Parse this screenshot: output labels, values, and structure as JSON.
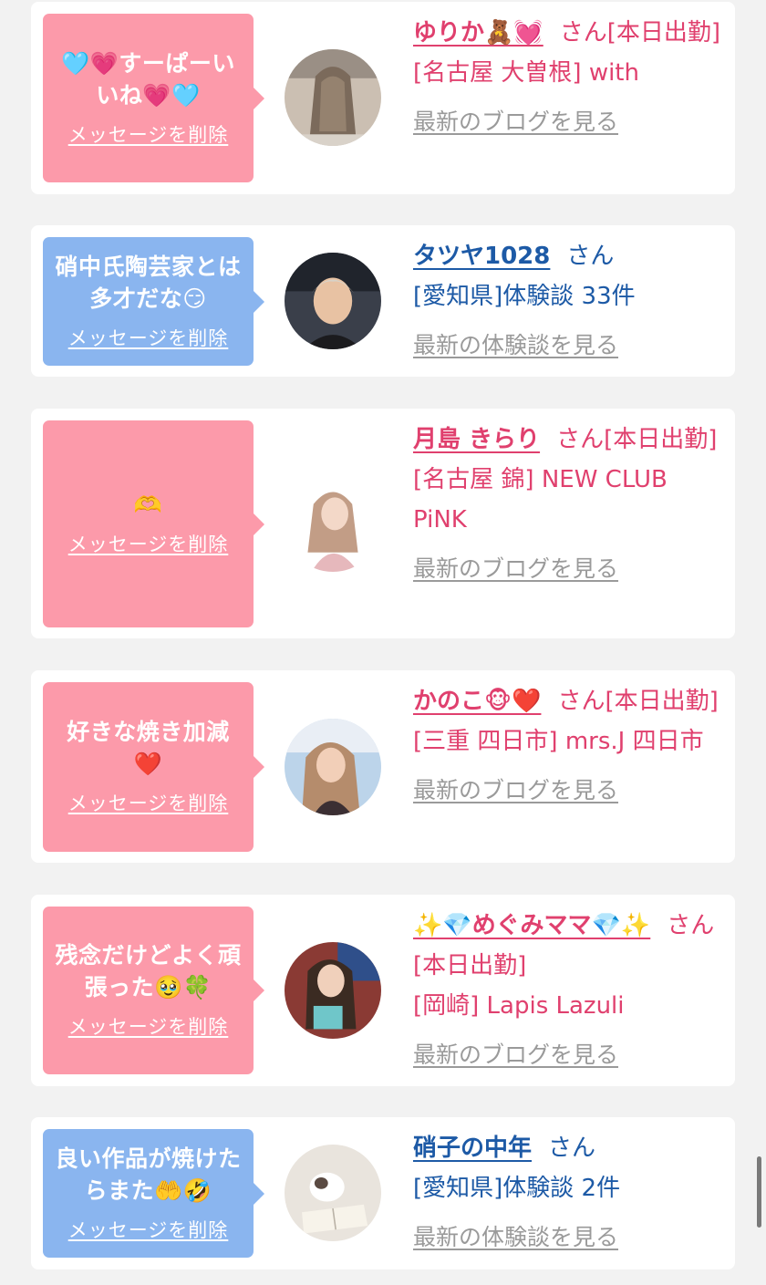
{
  "cards": [
    {
      "message": "🩵💗すーぱーいいね💗🩵",
      "delete_label": "メッセージを削除",
      "name": "ゆりか🧸💓",
      "suffix": "さん[本日出勤]",
      "detail": "[名古屋 大曽根] with",
      "link": "最新のブログを見る",
      "theme": "pink"
    },
    {
      "message": "硝中氏陶芸家とは多才だな😏",
      "delete_label": "メッセージを削除",
      "name": "タツヤ1028",
      "suffix": "さん",
      "detail": "[愛知県]体験談 33件",
      "link": "最新の体験談を見る",
      "theme": "blue"
    },
    {
      "message": "🫶",
      "delete_label": "メッセージを削除",
      "name": "月島 きらり",
      "suffix": "さん[本日出勤]",
      "detail": "[名古屋 錦] NEW CLUB PiNK",
      "link": "最新のブログを見る",
      "theme": "pink"
    },
    {
      "message": "好きな焼き加減❤️",
      "delete_label": "メッセージを削除",
      "name": "かのこ🐵❤️",
      "suffix": "さん[本日出勤]",
      "detail": "[三重 四日市] mrs.J 四日市",
      "link": "最新のブログを見る",
      "theme": "pink"
    },
    {
      "message": "残念だけどよく頑張った🥹🍀",
      "delete_label": "メッセージを削除",
      "name": "✨💎めぐみママ💎✨",
      "suffix": "さん[本日出勤]",
      "detail": "[岡崎] Lapis Lazuli",
      "link": "最新のブログを見る",
      "theme": "pink"
    },
    {
      "message": "良い作品が焼けたらまた🤲🤣",
      "delete_label": "メッセージを削除",
      "name": "硝子の中年",
      "suffix": "さん",
      "detail": "[愛知県]体験談 2件",
      "link": "最新の体験談を見る",
      "theme": "blue"
    }
  ]
}
